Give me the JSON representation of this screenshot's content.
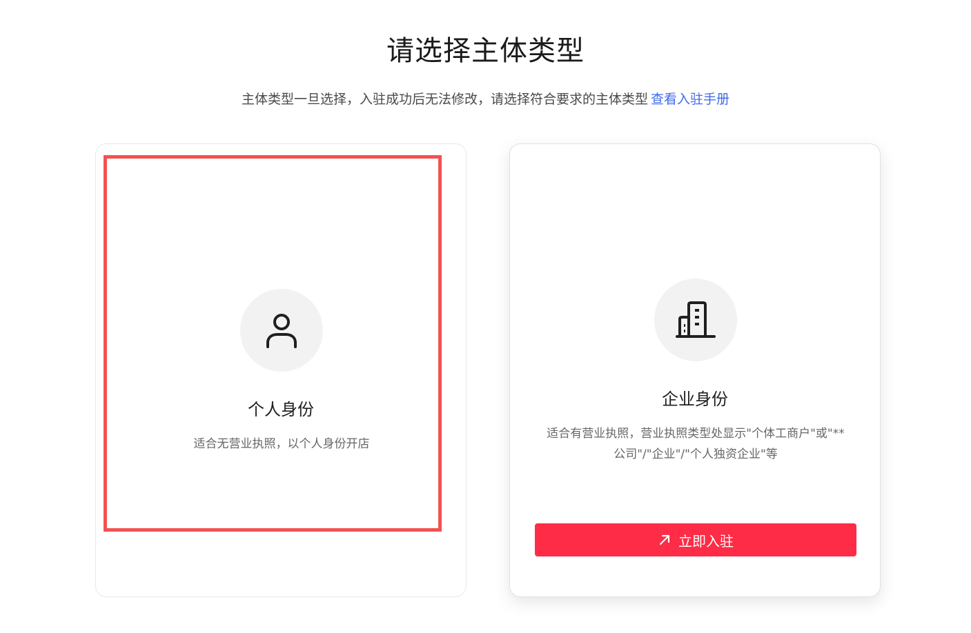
{
  "header": {
    "title": "请选择主体类型",
    "subtitle": "主体类型一旦选择，入驻成功后无法修改，请选择符合要求的主体类型",
    "manual_link": "查看入驻手册"
  },
  "cards": {
    "personal": {
      "icon": "user-icon",
      "heading": "个人身份",
      "description": "适合无营业执照，以个人身份开店"
    },
    "enterprise": {
      "icon": "building-icon",
      "heading": "企业身份",
      "description_line1": "适合有营业执照，营业执照类型处显示\"个体工商户\"或\"**",
      "description_line2": "公司\"/\"企业\"/\"个人独资企业\"等",
      "button_label": "立即入驻",
      "button_icon": "arrow-up-right-icon"
    }
  },
  "colors": {
    "primary_button": "#fe2c46",
    "link": "#3f6bea",
    "highlight_frame": "#f25252",
    "icon_bg": "#f2f2f2"
  }
}
